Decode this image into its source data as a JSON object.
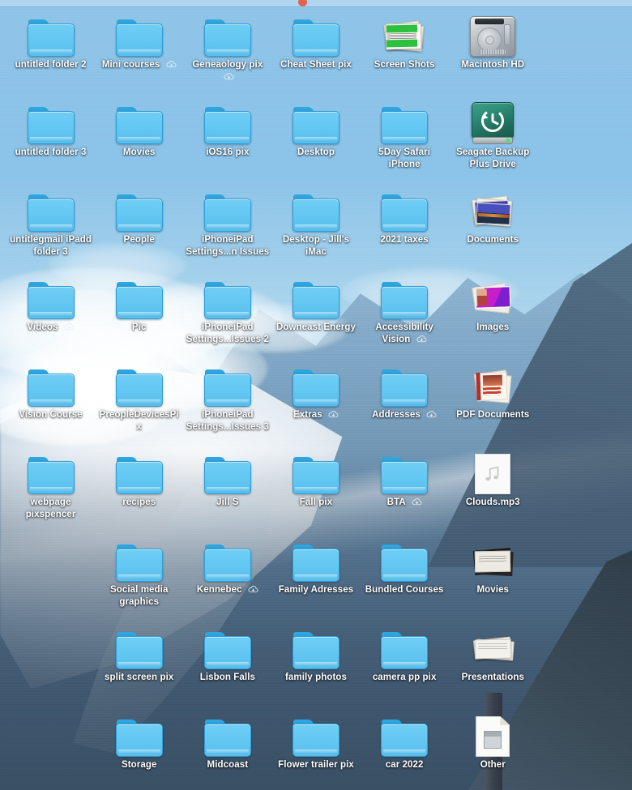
{
  "desktop": {
    "wallpaper_description": "Snow-capped mountain and glacier with blue sky and clouds",
    "accent_color": "#63c7f2",
    "label_color": "#ffffff",
    "grid_columns": 7,
    "grid_rows": 9
  },
  "icons": [
    {
      "name": "untitled folder 2",
      "type": "folder",
      "cloud": false,
      "row": 1,
      "col": 1
    },
    {
      "name": "Mini courses",
      "type": "folder",
      "cloud": true,
      "row": 1,
      "col": 2
    },
    {
      "name": "Geneaology pix",
      "type": "folder",
      "cloud": true,
      "row": 1,
      "col": 3
    },
    {
      "name": "Cheat Sheet pix",
      "type": "folder",
      "cloud": false,
      "row": 1,
      "col": 4
    },
    {
      "name": "Screen Shots",
      "type": "screenshots-stack",
      "cloud": false,
      "row": 1,
      "col": 5
    },
    {
      "name": "Macintosh HD",
      "type": "hard-drive",
      "cloud": false,
      "row": 1,
      "col": 6
    },
    {
      "name": "untitled folder 3",
      "type": "folder",
      "cloud": false,
      "row": 2,
      "col": 1
    },
    {
      "name": "Movies",
      "type": "folder",
      "cloud": false,
      "row": 2,
      "col": 2
    },
    {
      "name": "iOS16 pix",
      "type": "folder",
      "cloud": false,
      "row": 2,
      "col": 3
    },
    {
      "name": "Desktop",
      "type": "folder",
      "cloud": false,
      "row": 2,
      "col": 4
    },
    {
      "name": "5Day Safari iPhone",
      "type": "folder",
      "cloud": false,
      "row": 2,
      "col": 5
    },
    {
      "name": "Seagate Backup Plus Drive",
      "type": "time-machine-drive",
      "cloud": false,
      "row": 2,
      "col": 6
    },
    {
      "name": "untitlegmail iPadd folder 3",
      "type": "folder",
      "cloud": false,
      "row": 3,
      "col": 1
    },
    {
      "name": "People",
      "type": "folder",
      "cloud": false,
      "row": 3,
      "col": 2
    },
    {
      "name": "iPhoneiPad Settings...n Issues",
      "type": "folder",
      "cloud": false,
      "row": 3,
      "col": 3
    },
    {
      "name": "Desktop - Jill's iMac",
      "type": "folder",
      "cloud": false,
      "row": 3,
      "col": 4
    },
    {
      "name": "2021 taxes",
      "type": "folder",
      "cloud": false,
      "row": 3,
      "col": 5
    },
    {
      "name": "Documents",
      "type": "documents-stack",
      "cloud": false,
      "row": 3,
      "col": 6
    },
    {
      "name": "Videos",
      "type": "folder",
      "cloud": true,
      "row": 4,
      "col": 1
    },
    {
      "name": "Pic",
      "type": "folder",
      "cloud": false,
      "row": 4,
      "col": 2
    },
    {
      "name": "iPhoneiPad Settings...Issues 2",
      "type": "folder",
      "cloud": false,
      "row": 4,
      "col": 3
    },
    {
      "name": "Downeast Energy",
      "type": "folder",
      "cloud": false,
      "row": 4,
      "col": 4
    },
    {
      "name": "Accessibility Vision",
      "type": "folder",
      "cloud": true,
      "row": 4,
      "col": 5
    },
    {
      "name": "Images",
      "type": "images-stack",
      "cloud": false,
      "row": 4,
      "col": 6
    },
    {
      "name": "Vision Course",
      "type": "folder",
      "cloud": false,
      "row": 5,
      "col": 1
    },
    {
      "name": "PreopleDevicesPix",
      "type": "folder",
      "cloud": false,
      "row": 5,
      "col": 2
    },
    {
      "name": "iPhoneiPad Settings...Issues 3",
      "type": "folder",
      "cloud": false,
      "row": 5,
      "col": 3
    },
    {
      "name": "Extras",
      "type": "folder",
      "cloud": true,
      "row": 5,
      "col": 4
    },
    {
      "name": "Addresses",
      "type": "folder",
      "cloud": true,
      "row": 5,
      "col": 5
    },
    {
      "name": "PDF Documents",
      "type": "pdf-stack",
      "cloud": false,
      "row": 5,
      "col": 6
    },
    {
      "name": "webpage pixspencer",
      "type": "folder",
      "cloud": false,
      "row": 6,
      "col": 1
    },
    {
      "name": "recipes",
      "type": "folder",
      "cloud": false,
      "row": 6,
      "col": 2
    },
    {
      "name": "Jill S",
      "type": "folder",
      "cloud": false,
      "row": 6,
      "col": 3
    },
    {
      "name": "Fall pix",
      "type": "folder",
      "cloud": false,
      "row": 6,
      "col": 4
    },
    {
      "name": "BTA",
      "type": "folder",
      "cloud": true,
      "row": 6,
      "col": 5
    },
    {
      "name": "Clouds.mp3",
      "type": "audio-file",
      "cloud": false,
      "row": 6,
      "col": 6
    },
    {
      "name": "Social media graphics",
      "type": "folder",
      "cloud": false,
      "row": 7,
      "col": 2
    },
    {
      "name": "Kennebec",
      "type": "folder",
      "cloud": true,
      "row": 7,
      "col": 3
    },
    {
      "name": "Family Adresses",
      "type": "folder",
      "cloud": false,
      "row": 7,
      "col": 4
    },
    {
      "name": "Bundled Courses",
      "type": "folder",
      "cloud": false,
      "row": 7,
      "col": 5
    },
    {
      "name": "Movies",
      "type": "movies-stack",
      "cloud": false,
      "row": 7,
      "col": 6
    },
    {
      "name": "split screen pix",
      "type": "folder",
      "cloud": false,
      "row": 8,
      "col": 2
    },
    {
      "name": "Lisbon Falls",
      "type": "folder",
      "cloud": false,
      "row": 8,
      "col": 3
    },
    {
      "name": "family photos",
      "type": "folder",
      "cloud": false,
      "row": 8,
      "col": 4
    },
    {
      "name": "camera pp pix",
      "type": "folder",
      "cloud": false,
      "row": 8,
      "col": 5
    },
    {
      "name": "Presentations",
      "type": "presentations-stack",
      "cloud": false,
      "row": 8,
      "col": 6
    },
    {
      "name": "Storage",
      "type": "folder",
      "cloud": false,
      "row": 9,
      "col": 2
    },
    {
      "name": "Midcoast",
      "type": "folder",
      "cloud": false,
      "row": 9,
      "col": 3
    },
    {
      "name": "Flower trailer pix",
      "type": "folder",
      "cloud": false,
      "row": 9,
      "col": 4
    },
    {
      "name": "car 2022",
      "type": "folder",
      "cloud": false,
      "row": 9,
      "col": 5
    },
    {
      "name": "Other",
      "type": "document-file",
      "cloud": false,
      "row": 9,
      "col": 6
    }
  ]
}
